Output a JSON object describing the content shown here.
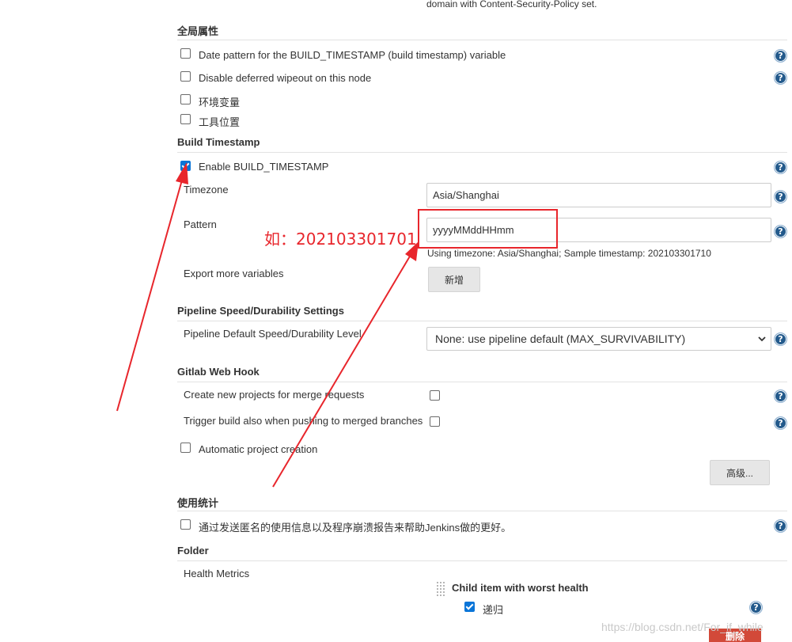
{
  "top_note": "domain with Content-Security-Policy set.",
  "global_properties": {
    "title": "全局属性",
    "options": [
      {
        "label": "Date pattern for the BUILD_TIMESTAMP (build timestamp) variable",
        "checked": false
      },
      {
        "label": "Disable deferred wipeout on this node",
        "checked": false
      },
      {
        "label": "环境变量",
        "checked": false
      },
      {
        "label": "工具位置",
        "checked": false
      }
    ]
  },
  "build_timestamp": {
    "title": "Build Timestamp",
    "enable_label": "Enable BUILD_TIMESTAMP",
    "enable_checked": true,
    "timezone_label": "Timezone",
    "timezone_value": "Asia/Shanghai",
    "pattern_label": "Pattern",
    "pattern_value": "yyyyMMddHHmm",
    "pattern_hint": "Using timezone: Asia/Shanghai; Sample timestamp: 202103301710",
    "export_label": "Export more variables",
    "add_button": "新增"
  },
  "annotation": {
    "text": "如：202103301701",
    "color": "#e8262c"
  },
  "pipeline": {
    "title": "Pipeline Speed/Durability Settings",
    "label": "Pipeline Default Speed/Durability Level",
    "selected": "None: use pipeline default (MAX_SURVIVABILITY)"
  },
  "gitlab": {
    "title": "Gitlab Web Hook",
    "create_label": "Create new projects for merge requests",
    "trigger_label": "Trigger build also when pushing to merged branches",
    "auto_label": "Automatic project creation",
    "advanced_button": "高级..."
  },
  "usage": {
    "title": "使用统计",
    "label": "通过发送匿名的使用信息以及程序崩溃报告来帮助Jenkins做的更好。"
  },
  "folder": {
    "title": "Folder",
    "health_label": "Health Metrics",
    "child_title": "Child item with worst health",
    "recursive_label": "递归",
    "recursive_checked": true,
    "delete_button": "删除"
  },
  "watermark": "https://blog.csdn.net/For_if_while",
  "icons": {
    "help": "help-icon",
    "chevron": "chevron-down-icon",
    "drag": "drag-handle-icon"
  }
}
